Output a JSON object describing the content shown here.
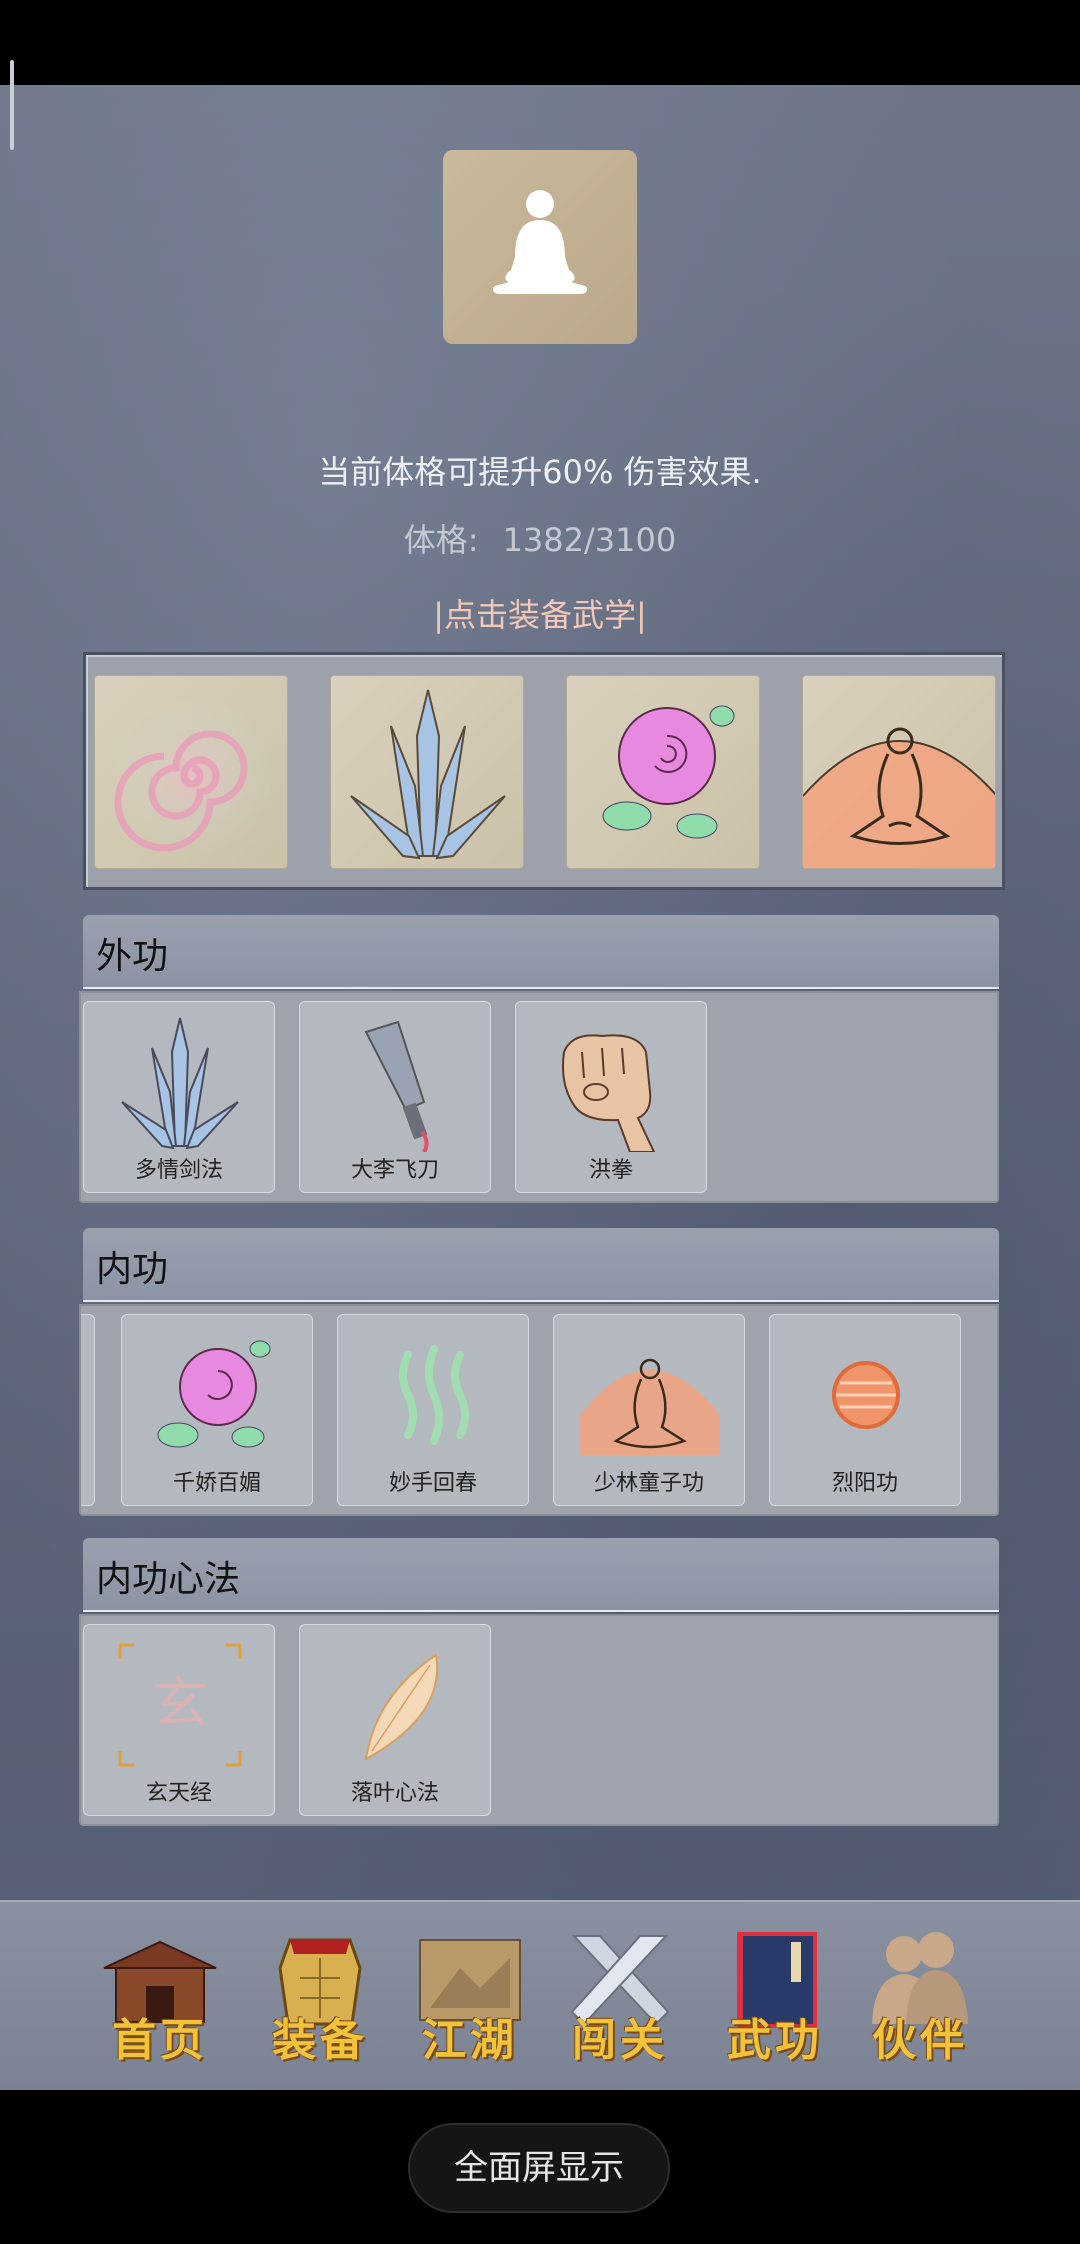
{
  "status_bar": {},
  "character": {
    "description": "当前体格可提升60% 伤害效果.",
    "stat_label": "体格:",
    "stat_value": "1382/3100",
    "equip_link": "|点击装备武学|"
  },
  "equipped_slots": [
    {
      "icon": "spiral-icon"
    },
    {
      "icon": "sword-icon"
    },
    {
      "icon": "rose-icon"
    },
    {
      "icon": "meditation-icon"
    }
  ],
  "sections": [
    {
      "title": "外功",
      "skills": [
        {
          "name": "多情剑法",
          "icon": "sword-icon"
        },
        {
          "name": "大李飞刀",
          "icon": "dagger-icon"
        },
        {
          "name": "洪拳",
          "icon": "fist-icon"
        }
      ]
    },
    {
      "title": "内功",
      "skills": [
        {
          "name": "千娇百媚",
          "icon": "rose-icon"
        },
        {
          "name": "妙手回春",
          "icon": "steam-icon"
        },
        {
          "name": "少林童子功",
          "icon": "meditation-icon"
        },
        {
          "name": "烈阳功",
          "icon": "sun-orb-icon"
        }
      ]
    },
    {
      "title": "内功心法",
      "skills": [
        {
          "name": "玄天经",
          "icon": "xuan-glyph-icon",
          "glyph": "玄"
        },
        {
          "name": "落叶心法",
          "icon": "leaf-icon"
        }
      ]
    }
  ],
  "nav": [
    {
      "label": "首页",
      "icon": "house-icon"
    },
    {
      "label": "装备",
      "icon": "armor-icon"
    },
    {
      "label": "江湖",
      "icon": "scroll-map-icon"
    },
    {
      "label": "闯关",
      "icon": "crossed-swords-icon"
    },
    {
      "label": "武功",
      "icon": "book-icon"
    },
    {
      "label": "伙伴",
      "icon": "companions-icon"
    }
  ],
  "system": {
    "fullscreen_label": "全面屏显示"
  },
  "colors": {
    "background": "#5f687c",
    "accent_text": "#f3c8b6",
    "nav_label": "#f2c23a"
  }
}
